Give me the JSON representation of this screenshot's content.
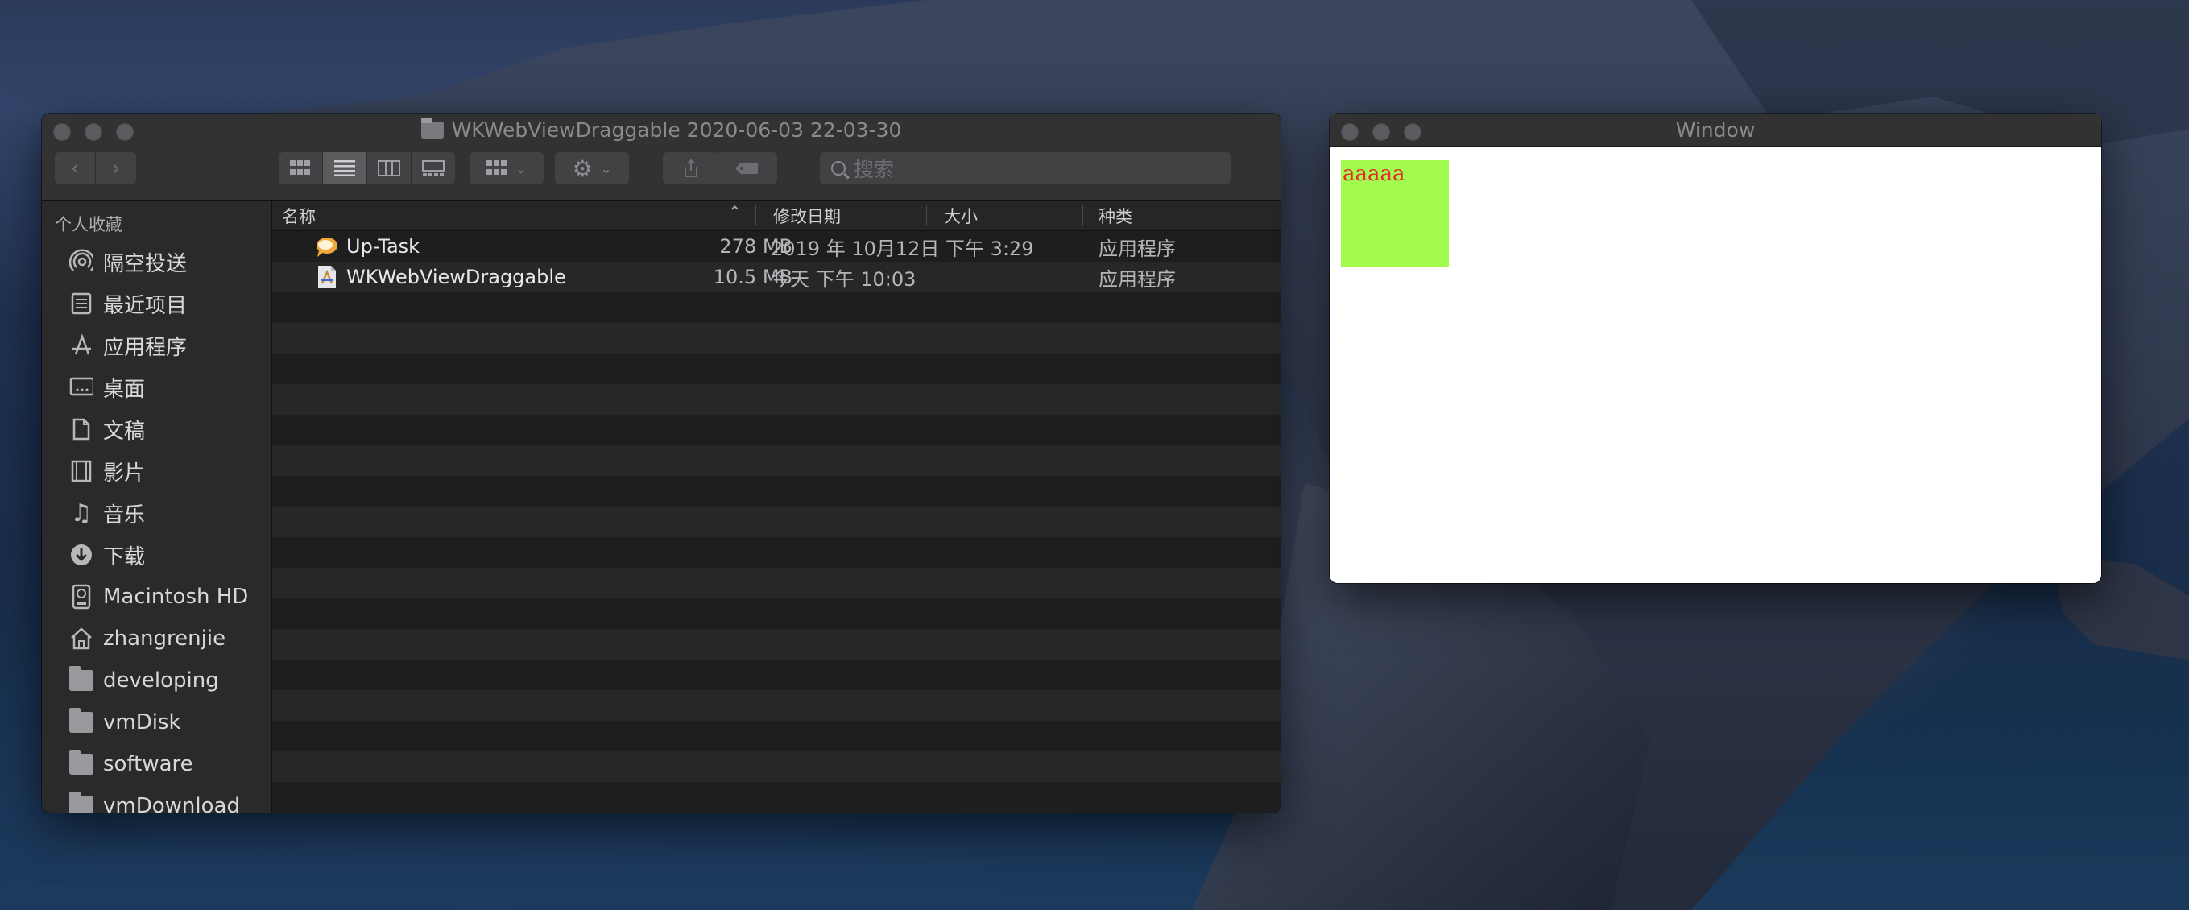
{
  "finder": {
    "title": "WKWebViewDraggable 2020-06-03 22-03-30",
    "search_placeholder": "搜索",
    "sidebar": {
      "heading": "个人收藏",
      "items": [
        {
          "label": "隔空投送",
          "icon": "airdrop-icon"
        },
        {
          "label": "最近项目",
          "icon": "recents-icon"
        },
        {
          "label": "应用程序",
          "icon": "applications-icon"
        },
        {
          "label": "桌面",
          "icon": "desktop-icon"
        },
        {
          "label": "文稿",
          "icon": "documents-icon"
        },
        {
          "label": "影片",
          "icon": "movies-icon"
        },
        {
          "label": "音乐",
          "icon": "music-icon"
        },
        {
          "label": "下载",
          "icon": "downloads-icon"
        },
        {
          "label": "Macintosh HD",
          "icon": "disk-icon"
        },
        {
          "label": "zhangrenjie",
          "icon": "home-icon"
        },
        {
          "label": "developing",
          "icon": "folder-icon"
        },
        {
          "label": "vmDisk",
          "icon": "folder-icon"
        },
        {
          "label": "software",
          "icon": "folder-icon"
        },
        {
          "label": "vmDownload",
          "icon": "folder-icon"
        }
      ]
    },
    "columns": {
      "name": "名称",
      "modified": "修改日期",
      "size": "大小",
      "kind": "种类"
    },
    "files": [
      {
        "name": "Up-Task",
        "modified": "2019 年 10月12日 下午 3:29",
        "size": "278 MB",
        "kind": "应用程序"
      },
      {
        "name": "WKWebViewDraggable",
        "modified": "今天 下午 10:03",
        "size": "10.5 MB",
        "kind": "应用程序"
      }
    ]
  },
  "window": {
    "title": "Window",
    "content_text": "aaaaa"
  }
}
